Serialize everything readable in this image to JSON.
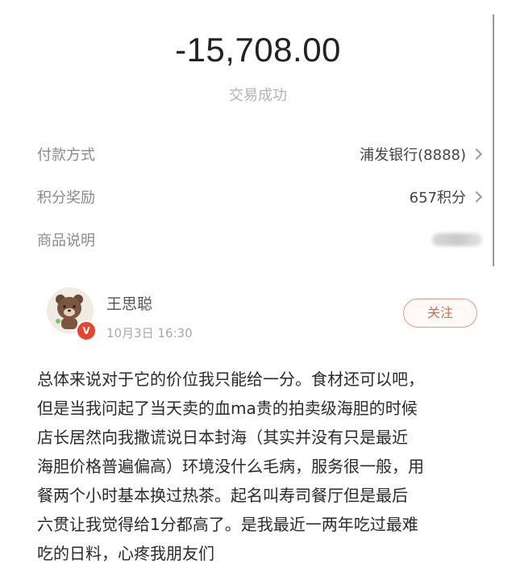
{
  "transaction": {
    "amount": "-15,708.00",
    "status": "交易成功"
  },
  "details": [
    {
      "label": "付款方式",
      "value": "浦发银行(8888)"
    },
    {
      "label": "积分奖励",
      "value": "657积分"
    },
    {
      "label": "商品说明"
    }
  ],
  "review": {
    "username": "王思聪",
    "time": "10月3日  16:30",
    "follow_label": "关注",
    "verified_mark": "V",
    "lines": [
      "总体来说对于它的价位我只能给一分。食材还可以吧，",
      "但是当我问起了当天卖的血ma贵的拍卖级海胆的时候",
      "店长居然向我撒谎说日本封海（其实并没有只是最近",
      "海胆价格普遍偏高）环境没什么毛病，服务很一般，用",
      "餐两个小时基本换过热茶。起名叫寿司餐厅但是最后",
      "六贯让我觉得给1分都高了。是我最近一两年吃过最难",
      "吃的日料，心疼我朋友们"
    ]
  }
}
